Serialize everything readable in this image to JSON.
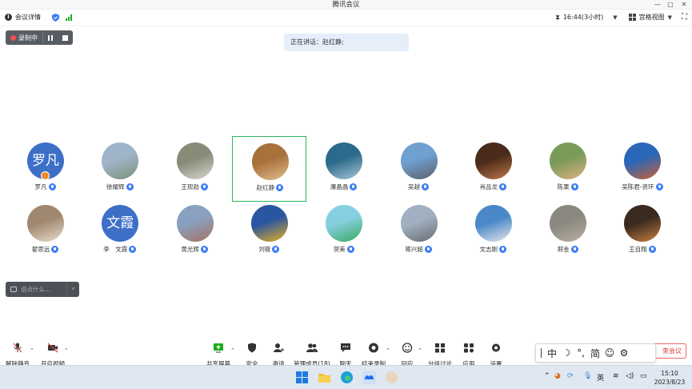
{
  "window": {
    "title": "腾讯会议"
  },
  "infobar": {
    "meeting_details": "会议详情",
    "duration": "16:44(3小时)",
    "view_mode": "宫格视图"
  },
  "recording": {
    "label": "录制中"
  },
  "speaking": {
    "text": "正在讲话：赵红静;"
  },
  "participants": [
    {
      "name": "罗凡",
      "avatar_text": "罗凡",
      "host": true
    },
    {
      "name": "徐耀辉"
    },
    {
      "name": "王现勋"
    },
    {
      "name": "赵红静",
      "active": true
    },
    {
      "name": "廉晶晶"
    },
    {
      "name": "吴越"
    },
    {
      "name": "肖品龙"
    },
    {
      "name": "陈果"
    },
    {
      "name": "吴陈君-资环"
    },
    {
      "name": "翟思远"
    },
    {
      "name": "李　文霞",
      "avatar_text": "文霞"
    },
    {
      "name": "黄光辉"
    },
    {
      "name": "刘筱"
    },
    {
      "name": "贺美"
    },
    {
      "name": "蒋兴超"
    },
    {
      "name": "文志刚"
    },
    {
      "name": "邢金"
    },
    {
      "name": "王自翔"
    }
  ],
  "chat": {
    "placeholder": "说点什么..."
  },
  "toolbar": {
    "unmute": "解除静音",
    "start_video": "开启视频",
    "share_screen": "共享屏幕",
    "security": "安全",
    "invite": "邀请",
    "manage_members": "管理成员(18)",
    "chat": "聊天",
    "end_recording": "结束录制",
    "react": "回应",
    "breakout": "分组讨论",
    "apps": "应用",
    "settings": "设置",
    "end_meeting": "束会议"
  },
  "ime": {
    "chinese": "中",
    "moon": "☽",
    "punct": "°,",
    "simplified": "简",
    "emoji": "☺",
    "gear": "⚙"
  },
  "taskbar": {
    "ime_lang": "英",
    "time": "15:10",
    "date": "2023/8/23"
  },
  "colors": {
    "accent": "#3b7cf6",
    "active_border": "#2cb55c",
    "record": "#f05050",
    "end": "#e04040"
  }
}
